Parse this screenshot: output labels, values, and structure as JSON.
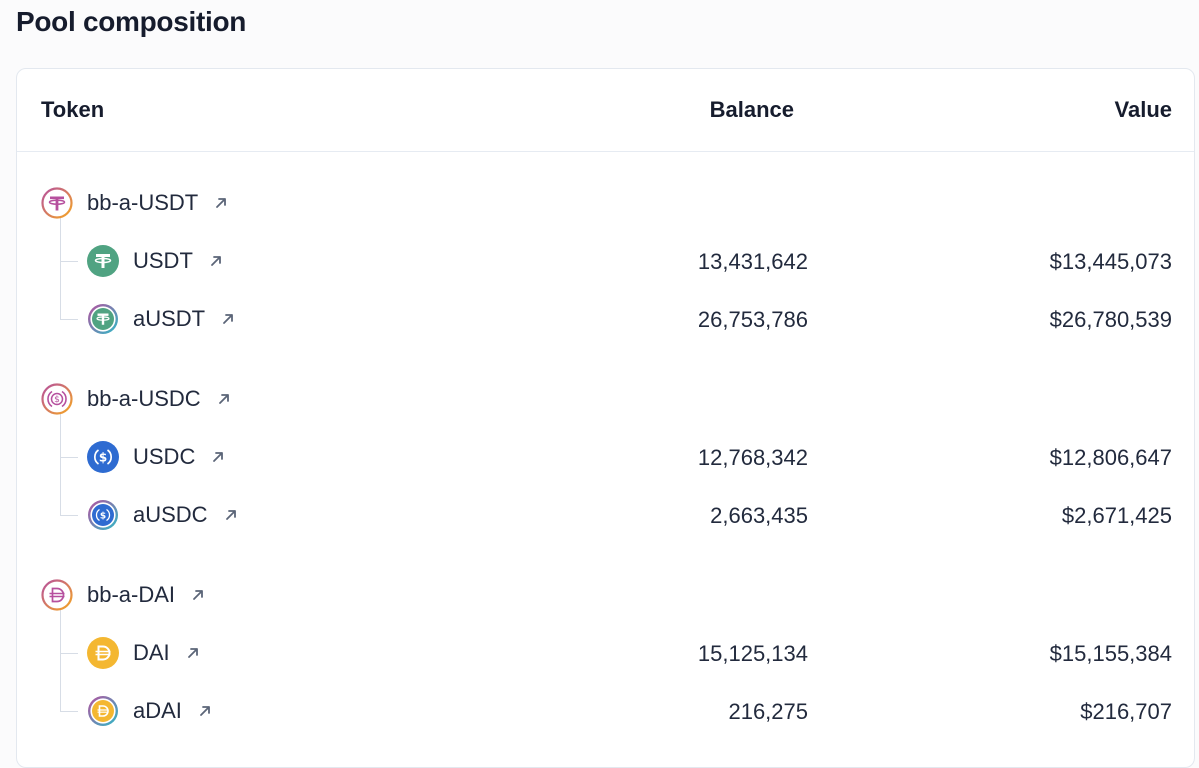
{
  "page": {
    "title": "Pool composition"
  },
  "table": {
    "headers": {
      "token": "Token",
      "balance": "Balance",
      "value": "Value"
    },
    "groups": [
      {
        "parent": {
          "name": "bb-a-USDT",
          "icon": "bb-a-usdt-icon"
        },
        "children": [
          {
            "name": "USDT",
            "icon": "usdt-icon",
            "balance": "13,431,642",
            "value": "$13,445,073"
          },
          {
            "name": "aUSDT",
            "icon": "ausdt-icon",
            "balance": "26,753,786",
            "value": "$26,780,539"
          }
        ]
      },
      {
        "parent": {
          "name": "bb-a-USDC",
          "icon": "bb-a-usdc-icon"
        },
        "children": [
          {
            "name": "USDC",
            "icon": "usdc-icon",
            "balance": "12,768,342",
            "value": "$12,806,647"
          },
          {
            "name": "aUSDC",
            "icon": "ausdc-icon",
            "balance": "2,663,435",
            "value": "$2,671,425"
          }
        ]
      },
      {
        "parent": {
          "name": "bb-a-DAI",
          "icon": "bb-a-dai-icon"
        },
        "children": [
          {
            "name": "DAI",
            "icon": "dai-icon",
            "balance": "15,125,134",
            "value": "$15,155,384"
          },
          {
            "name": "aDAI",
            "icon": "adai-icon",
            "balance": "216,275",
            "value": "$216,707"
          }
        ]
      }
    ]
  },
  "colors": {
    "usdt": "#50a382",
    "usdc": "#2e6bd1",
    "dai": "#f4b731",
    "aave_ring": [
      "#b6509e",
      "#2ebac6"
    ],
    "link_arrow": "#5b6578",
    "tree_line": "#d7dde6"
  }
}
